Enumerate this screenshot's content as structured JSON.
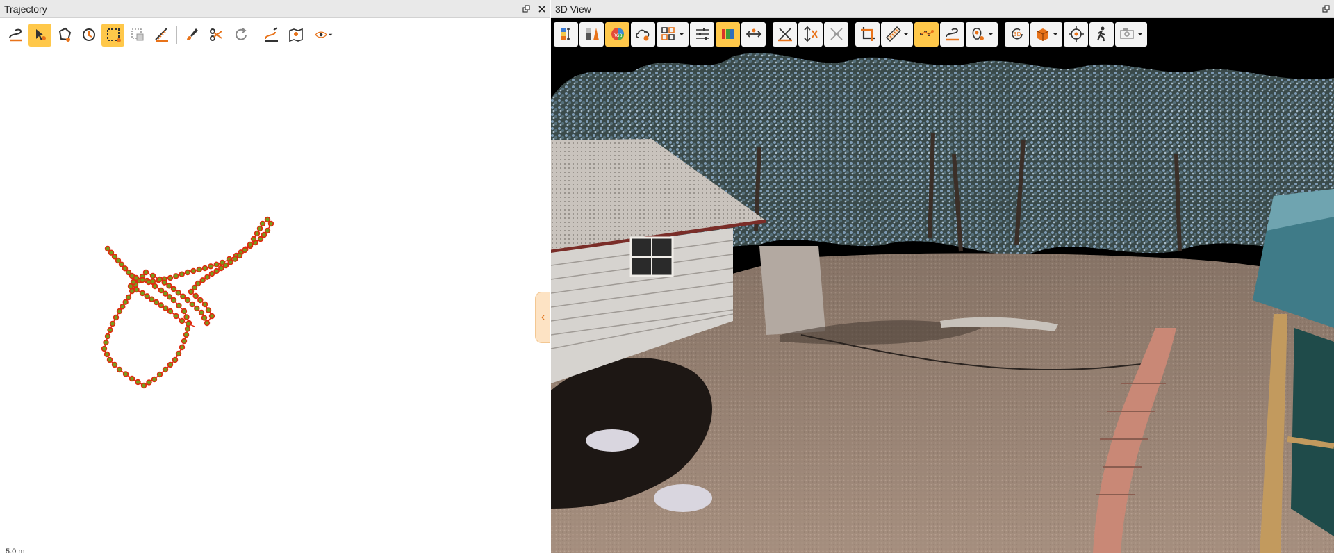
{
  "left_panel": {
    "title": "Trajectory",
    "scale_text": "5.0 m",
    "toolbar": [
      {
        "name": "trajectory-display-icon"
      },
      {
        "name": "select-point-icon",
        "active": true
      },
      {
        "name": "polygon-select-icon"
      },
      {
        "name": "circle-select-icon"
      },
      {
        "name": "rectangle-select-icon",
        "active": true
      },
      {
        "name": "clear-selection-icon"
      },
      {
        "name": "measure-ruler-icon"
      },
      {
        "name": "separator"
      },
      {
        "name": "brush-edit-icon"
      },
      {
        "name": "cut-settings-icon"
      },
      {
        "name": "rotate-icon"
      },
      {
        "name": "separator"
      },
      {
        "name": "trajectory-edit-icon"
      },
      {
        "name": "map-pin-icon"
      },
      {
        "name": "eye-visibility-icon",
        "dropdown": true
      }
    ],
    "trajectory_color": "#e02a10",
    "trajectory_fill": "#7a9a1a"
  },
  "right_panel": {
    "title": "3D View",
    "toolbar": [
      {
        "name": "color-by-elevation-icon"
      },
      {
        "name": "color-by-intensity-icon"
      },
      {
        "name": "color-by-rgb-icon",
        "active": true
      },
      {
        "name": "cloud-settings-icon"
      },
      {
        "name": "layout-grid-icon",
        "dropdown": true
      },
      {
        "name": "adjust-sliders-icon"
      },
      {
        "name": "color-bar-icon",
        "active": true
      },
      {
        "name": "measure-distance-icon"
      },
      {
        "name": "gap"
      },
      {
        "name": "measure-horizontal-icon"
      },
      {
        "name": "measure-vertical-icon"
      },
      {
        "name": "measure-clear-icon"
      },
      {
        "name": "gap"
      },
      {
        "name": "crop-icon"
      },
      {
        "name": "ruler-icon",
        "dropdown": true
      },
      {
        "name": "point-pick-icon",
        "active": true
      },
      {
        "name": "trajectory-view-icon"
      },
      {
        "name": "annotation-icon",
        "dropdown": true
      },
      {
        "name": "gap"
      },
      {
        "name": "view-3d-icon"
      },
      {
        "name": "box-view-icon",
        "dropdown": true
      },
      {
        "name": "center-target-icon"
      },
      {
        "name": "walk-mode-icon"
      },
      {
        "name": "screenshot-icon",
        "dropdown": true
      }
    ]
  },
  "colors": {
    "accent": "#e8731a",
    "active": "#ffc84a",
    "title_bar": "#e9e9e9"
  }
}
